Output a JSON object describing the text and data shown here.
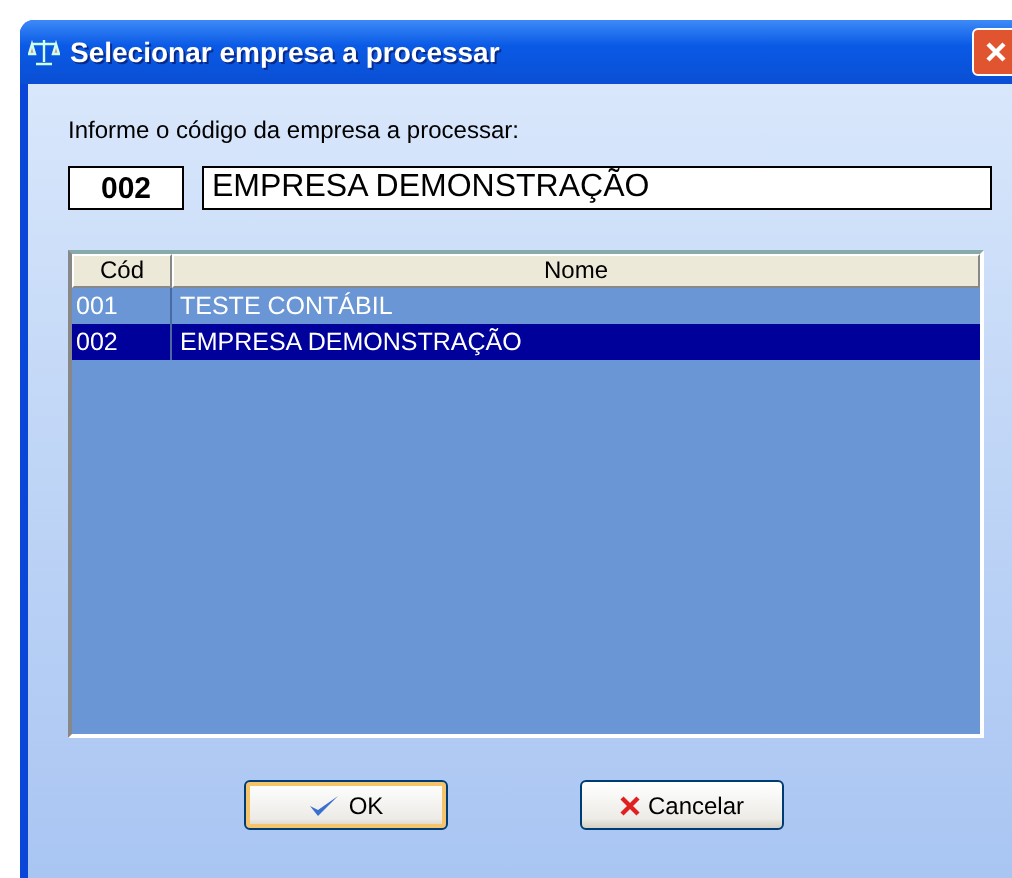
{
  "window": {
    "title": "Selecionar empresa a processar"
  },
  "prompt": "Informe o código da empresa a processar:",
  "code_field": {
    "value": "002"
  },
  "name_field": {
    "value": "EMPRESA DEMONSTRAÇÃO"
  },
  "table": {
    "columns": [
      "Cód",
      "Nome"
    ],
    "rows": [
      {
        "cells": [
          "001",
          "TESTE CONTÁBIL"
        ],
        "selected": false
      },
      {
        "cells": [
          "002",
          "EMPRESA DEMONSTRAÇÃO"
        ],
        "selected": true
      }
    ]
  },
  "buttons": [
    {
      "label": "OK",
      "kind": "ok",
      "focused": true
    },
    {
      "label": "Cancelar",
      "kind": "cancel",
      "focused": false
    }
  ]
}
